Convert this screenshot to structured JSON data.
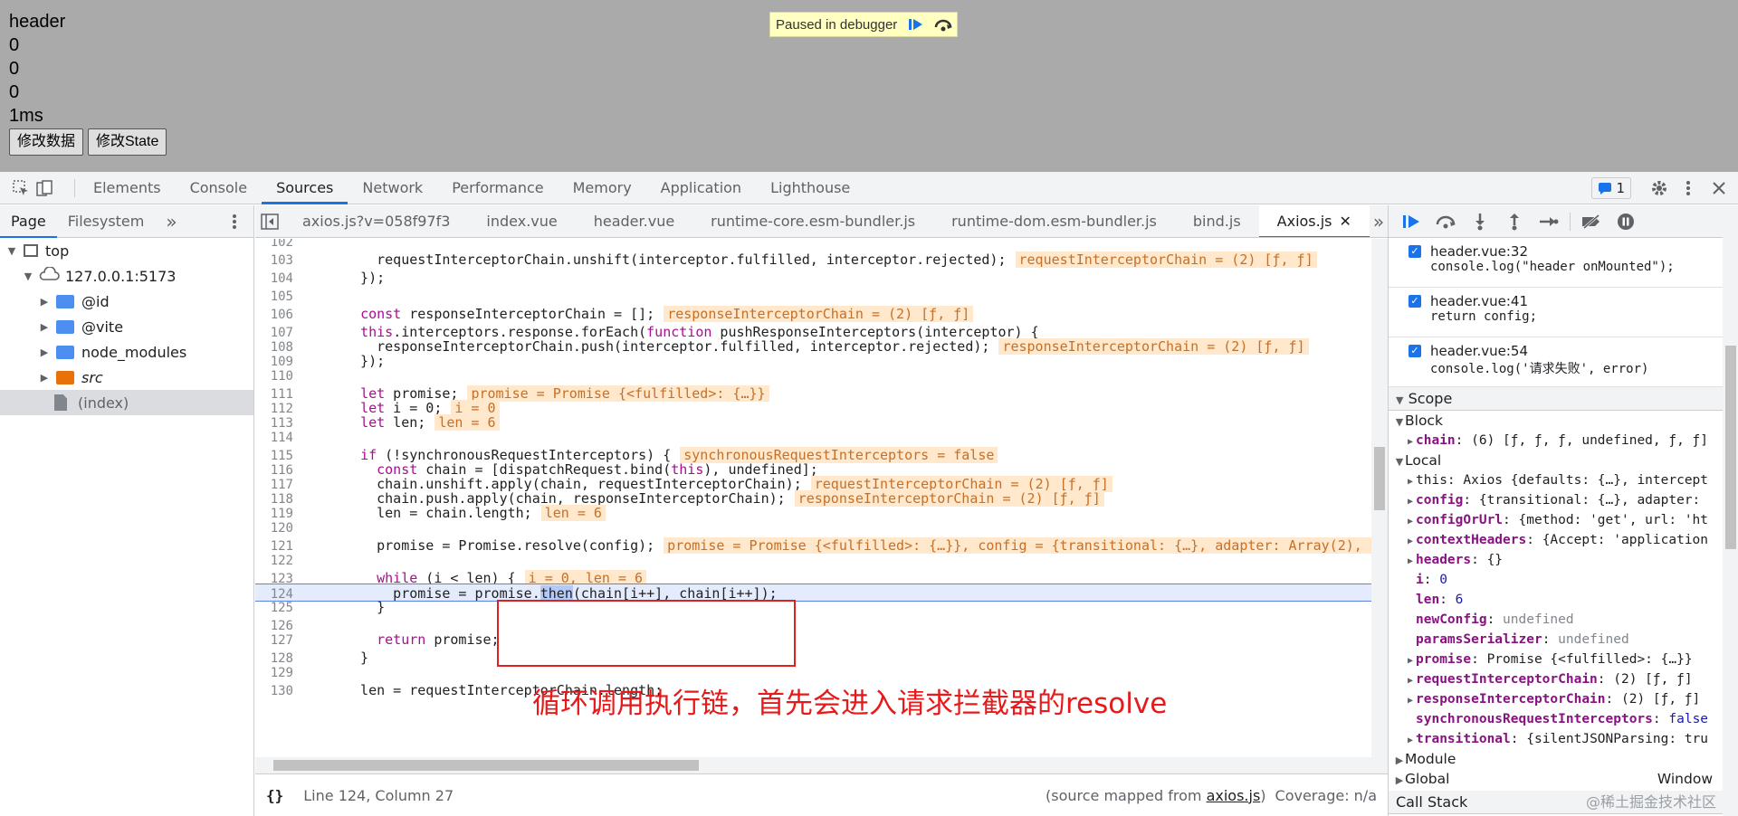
{
  "page": {
    "heading": "header",
    "values": [
      "0",
      "0",
      "0"
    ],
    "time": "1ms",
    "buttons": [
      "修改数据",
      "修改State"
    ],
    "paused_label": "Paused in debugger"
  },
  "devtools": {
    "main_tabs": [
      "Elements",
      "Console",
      "Sources",
      "Network",
      "Performance",
      "Memory",
      "Application",
      "Lighthouse"
    ],
    "active_main_tab": "Sources",
    "issues_count": "1",
    "navigator": {
      "tabs": [
        "Page",
        "Filesystem"
      ],
      "more": "»",
      "tree": [
        {
          "label": "top",
          "depth": 0,
          "kind": "frame",
          "expanded": true
        },
        {
          "label": "127.0.0.1:5173",
          "depth": 1,
          "kind": "cloud",
          "expanded": true
        },
        {
          "label": "@id",
          "depth": 2,
          "kind": "folder"
        },
        {
          "label": "@vite",
          "depth": 2,
          "kind": "folder"
        },
        {
          "label": "node_modules",
          "depth": 2,
          "kind": "folder"
        },
        {
          "label": "src",
          "depth": 2,
          "kind": "folder-orange"
        },
        {
          "label": "(index)",
          "depth": 2,
          "kind": "file",
          "selected": true
        }
      ]
    },
    "editor_tabs": [
      "axios.js?v=058f97f3",
      "index.vue",
      "header.vue",
      "runtime-core.esm-bundler.js",
      "runtime-dom.esm-bundler.js",
      "bind.js",
      "Axios.js"
    ],
    "active_editor_tab": "Axios.js",
    "code_lines": [
      {
        "n": "102",
        "parts": []
      },
      {
        "n": "103",
        "parts": [
          {
            "t": "    requestInterceptorChain.unshift(interceptor.fulfilled, interceptor.rejected);"
          }
        ],
        "inline": "requestInterceptorChain = (2) [ƒ, ƒ]"
      },
      {
        "n": "104",
        "parts": [
          {
            "t": "  });"
          }
        ]
      },
      {
        "n": "105",
        "parts": []
      },
      {
        "n": "106",
        "parts": [
          {
            "t": "  "
          },
          {
            "t": "const",
            "k": true
          },
          {
            "t": " responseInterceptorChain = [];"
          }
        ],
        "inline": "responseInterceptorChain = (2) [ƒ, ƒ]"
      },
      {
        "n": "107",
        "parts": [
          {
            "t": "  "
          },
          {
            "t": "this",
            "k": true
          },
          {
            "t": ".interceptors.response.forEach("
          },
          {
            "t": "function",
            "k": true
          },
          {
            "t": " pushResponseInterceptors(interceptor) {"
          }
        ]
      },
      {
        "n": "108",
        "parts": [
          {
            "t": "    responseInterceptorChain.push(interceptor.fulfilled, interceptor.rejected);"
          }
        ],
        "inline": "responseInterceptorChain = (2) [ƒ, ƒ]"
      },
      {
        "n": "109",
        "parts": [
          {
            "t": "  });"
          }
        ]
      },
      {
        "n": "110",
        "parts": []
      },
      {
        "n": "111",
        "parts": [
          {
            "t": "  "
          },
          {
            "t": "let",
            "k": true
          },
          {
            "t": " promise;"
          }
        ],
        "inline": "promise = Promise {<fulfilled>: {…}}"
      },
      {
        "n": "112",
        "parts": [
          {
            "t": "  "
          },
          {
            "t": "let",
            "k": true
          },
          {
            "t": " i = 0;"
          }
        ],
        "inline": "i = 0"
      },
      {
        "n": "113",
        "parts": [
          {
            "t": "  "
          },
          {
            "t": "let",
            "k": true
          },
          {
            "t": " len;"
          }
        ],
        "inline": "len = 6"
      },
      {
        "n": "114",
        "parts": []
      },
      {
        "n": "115",
        "parts": [
          {
            "t": "  "
          },
          {
            "t": "if",
            "k": true
          },
          {
            "t": " (!synchronousRequestInterceptors) {"
          }
        ],
        "inline": "synchronousRequestInterceptors = false"
      },
      {
        "n": "116",
        "parts": [
          {
            "t": "    "
          },
          {
            "t": "const",
            "k": true
          },
          {
            "t": " chain = [dispatchRequest.bind("
          },
          {
            "t": "this",
            "k": true
          },
          {
            "t": "), undefined];"
          }
        ]
      },
      {
        "n": "117",
        "parts": [
          {
            "t": "    chain.unshift.apply(chain, requestInterceptorChain);"
          }
        ],
        "inline": "requestInterceptorChain = (2) [ƒ, ƒ]"
      },
      {
        "n": "118",
        "parts": [
          {
            "t": "    chain.push.apply(chain, responseInterceptorChain);"
          }
        ],
        "inline": "responseInterceptorChain = (2) [ƒ, ƒ]"
      },
      {
        "n": "119",
        "parts": [
          {
            "t": "    len = chain.length;"
          }
        ],
        "inline": "len = 6"
      },
      {
        "n": "120",
        "parts": []
      },
      {
        "n": "121",
        "parts": [
          {
            "t": "    promise = Promise.resolve(config);"
          }
        ],
        "inline": "promise = Promise {<fulfilled>: {…}}, config = {transitional: {…}, adapter: Array(2), t"
      },
      {
        "n": "122",
        "parts": []
      },
      {
        "n": "123",
        "parts": [
          {
            "t": "    "
          },
          {
            "t": "while",
            "k": true
          },
          {
            "t": " (i < len) {"
          }
        ],
        "inline": "i = 0, len = 6"
      },
      {
        "n": "124",
        "parts": [
          {
            "t": "      promise = promise."
          },
          {
            "t": "then",
            "h": true
          },
          {
            "t": "(chain[i++], chain[i++]);"
          }
        ],
        "current": true
      },
      {
        "n": "125",
        "parts": [
          {
            "t": "    }"
          }
        ]
      },
      {
        "n": "126",
        "parts": []
      },
      {
        "n": "127",
        "parts": [
          {
            "t": "    "
          },
          {
            "t": "return",
            "k": true
          },
          {
            "t": " promise;"
          }
        ]
      },
      {
        "n": "128",
        "parts": [
          {
            "t": "  }"
          }
        ]
      },
      {
        "n": "129",
        "parts": []
      },
      {
        "n": "130",
        "parts": [
          {
            "t": "  len = requestInterceptorChain.length;"
          }
        ]
      }
    ],
    "annotation": "循环调用执行链，首先会进入请求拦截器的resolve",
    "status": {
      "position": "Line 124, Column 27",
      "source_mapped_prefix": "(source mapped from ",
      "source_mapped_link": "axios.js",
      "source_mapped_suffix": ")",
      "coverage": "Coverage: n/a"
    },
    "breakpoints": [
      {
        "name": "header.vue:32",
        "code": "console.log(\"header onMounted\");"
      },
      {
        "name": "header.vue:41",
        "code": "return config;"
      },
      {
        "name": "header.vue:54",
        "code": "console.log('请求失败', error)"
      }
    ],
    "scope_title": "Scope",
    "block_title": "Block",
    "local_title": "Local",
    "block_vars": [
      {
        "key": "chain",
        "value": "(6) [ƒ, ƒ, ƒ, undefined, ƒ, ƒ]",
        "expandable": true
      }
    ],
    "local_vars": [
      {
        "key": "this",
        "value": "Axios {defaults: {…}, intercept",
        "expandable": true,
        "plain": true
      },
      {
        "key": "config",
        "value": "{transitional: {…}, adapter: ",
        "expandable": true
      },
      {
        "key": "configOrUrl",
        "value": "{method: 'get', url: 'ht",
        "expandable": true
      },
      {
        "key": "contextHeaders",
        "value": "{Accept: 'application",
        "expandable": true
      },
      {
        "key": "headers",
        "value": "{}",
        "expandable": true
      },
      {
        "key": "i",
        "value": "0",
        "num": true
      },
      {
        "key": "len",
        "value": "6",
        "num": true
      },
      {
        "key": "newConfig",
        "value": "undefined",
        "undef": true
      },
      {
        "key": "paramsSerializer",
        "value": "undefined",
        "undef": true
      },
      {
        "key": "promise",
        "value": "Promise {<fulfilled>: {…}}",
        "expandable": true
      },
      {
        "key": "requestInterceptorChain",
        "value": "(2) [ƒ, ƒ]",
        "expandable": true
      },
      {
        "key": "responseInterceptorChain",
        "value": "(2) [ƒ, ƒ]",
        "expandable": true
      },
      {
        "key": "synchronousRequestInterceptors",
        "value": "false",
        "num": true
      },
      {
        "key": "transitional",
        "value": "{silentJSONParsing: tru",
        "expandable": true
      }
    ],
    "module_title": "Module",
    "global_title": "Global",
    "global_value": "Window",
    "callstack_title": "Call Stack"
  },
  "watermark": "@稀土掘金技术社区"
}
